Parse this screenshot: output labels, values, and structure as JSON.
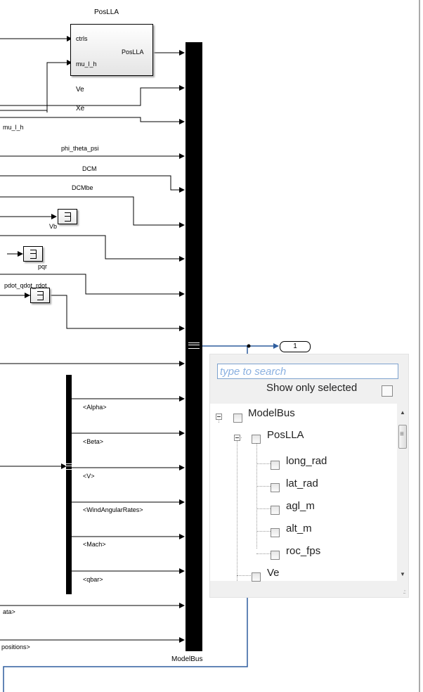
{
  "model": {
    "poslla_block": {
      "title": "PosLLA",
      "input_ports": [
        "ctrls",
        "mu_l_h"
      ],
      "output_port": "PosLLA"
    },
    "bus_creator_label": "ModelBus",
    "outport_number": "1",
    "signal_labels": {
      "ve": "Ve",
      "xe": "Xe",
      "mu_l_h": "mu_l_h",
      "phi_theta_psi": "phi_theta_psi",
      "dcm": "DCM",
      "dcmbe": "DCMbe",
      "vb": "Vb",
      "pqr": "pqr",
      "pdot_qdot_rdot": "pdot_qdot_rdot",
      "ata_truncated": "ata>",
      "positions_truncated": "positions>"
    },
    "bus_selector_outputs": [
      "<Alpha>",
      "<Beta>",
      "<V>",
      "<WindAngularRates>",
      "<Mach>",
      "<qbar>"
    ]
  },
  "signal_selector_popup": {
    "search_placeholder": "type to search",
    "search_value": "",
    "show_only_selected_label": "Show only selected",
    "show_only_selected_checked": false,
    "tree": {
      "root_label": "ModelBus",
      "child_label": "PosLLA",
      "leaf_labels": [
        "long_rad",
        "lat_rad",
        "agl_m",
        "alt_m",
        "roc_fps"
      ],
      "next_label": "Ve"
    }
  },
  "colors": {
    "selected_line": "#2e5d9e",
    "search_border": "#7da2ce",
    "placeholder": "#8ab0e0"
  }
}
